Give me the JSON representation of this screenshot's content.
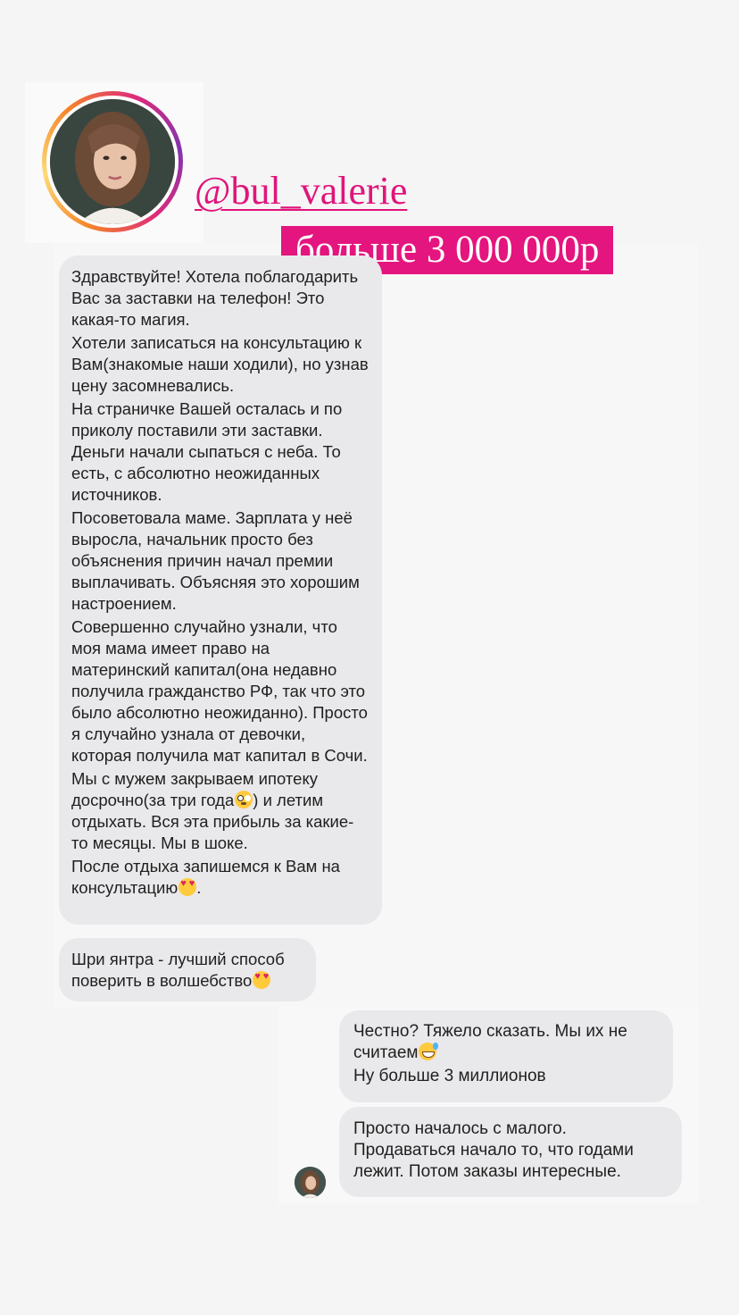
{
  "header": {
    "handle": "@bul_valerie",
    "banner": "больше 3 000 000р"
  },
  "messages": {
    "incoming_1": {
      "paragraphs": [
        "Здравствуйте! Хотела поблагодарить Вас за заставки на телефон! Это какая-то магия.",
        "Хотели записаться на консультацию к Вам(знакомые наши ходили), но узнав цену засомневались.",
        "На страничке Вашей осталась и по приколу поставили эти заставки. Деньги начали сыпаться с неба. То есть, с абсолютно неожиданных источников.",
        "Посоветовала маме. Зарплата у неё выросла, начальник просто без объяснения причин начал премии выплачивать. Объясняя это хорошим настроением.",
        "Совершенно случайно узнали, что моя мама имеет право на материнский капитал(она недавно получила гражданство РФ, так что это было абсолютно неожиданно). Просто я случайно узнала от девочки, которая получила мат капитал в Сочи."
      ],
      "p6_before": "Мы с мужем закрываем ипотеку досрочно(за три года",
      "p6_after": ") и летим отдыхать. Вся эта прибыль за какие-то месяцы. Мы в шоке.",
      "p7_text": "После отдыха запишемся к Вам на консультацию",
      "p7_end": "."
    },
    "incoming_2": {
      "text": "Шри янтра - лучший способ поверить в волшебство"
    },
    "outgoing_1": {
      "line1": "Честно? Тяжело сказать. Мы их не считаем",
      "line2": "Ну больше 3 миллионов"
    },
    "outgoing_2": {
      "text": "Просто началось с малого. Продаваться начало то, что годами лежит. Потом заказы интересные."
    }
  },
  "icons": {
    "emoji_hearts": "smiling-face-with-heart-eyes",
    "emoji_flushed": "flushed-face",
    "emoji_sweat": "grinning-face-with-sweat"
  },
  "colors": {
    "accent_pink": "#e4157e",
    "bubble_gray": "#e9e9eb"
  }
}
